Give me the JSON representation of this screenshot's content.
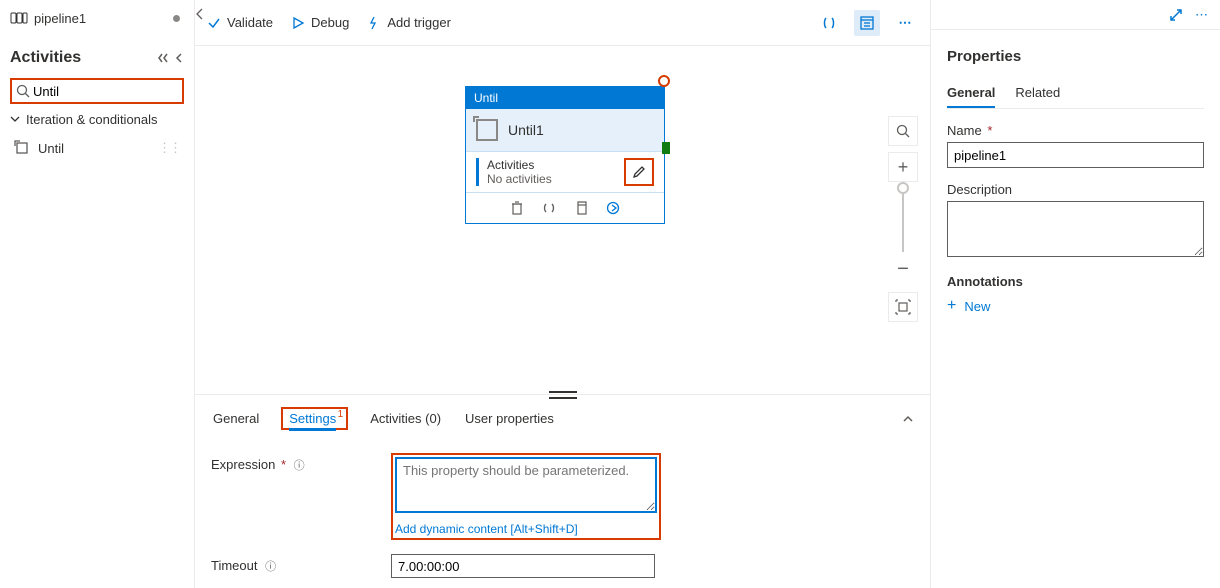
{
  "tabs": {
    "pipeline_name": "pipeline1"
  },
  "sidebar": {
    "title": "Activities",
    "search_value": "Until",
    "group": "Iteration & conditionals",
    "item": "Until"
  },
  "toolbar": {
    "validate": "Validate",
    "debug": "Debug",
    "add_trigger": "Add trigger"
  },
  "node": {
    "type": "Until",
    "title": "Until1",
    "section_title": "Activities",
    "section_sub": "No activities"
  },
  "bottom": {
    "tabs": {
      "general": "General",
      "settings": "Settings",
      "settings_badge": "1",
      "activities": "Activities (0)",
      "user_props": "User properties"
    },
    "expression_label": "Expression",
    "expression_placeholder": "This property should be parameterized.",
    "dynamic_link": "Add dynamic content [Alt+Shift+D]",
    "timeout_label": "Timeout",
    "timeout_value": "7.00:00:00"
  },
  "props": {
    "title": "Properties",
    "tabs": {
      "general": "General",
      "related": "Related"
    },
    "name_label": "Name",
    "name_value": "pipeline1",
    "description_label": "Description",
    "annotations_label": "Annotations",
    "new_label": "New"
  }
}
